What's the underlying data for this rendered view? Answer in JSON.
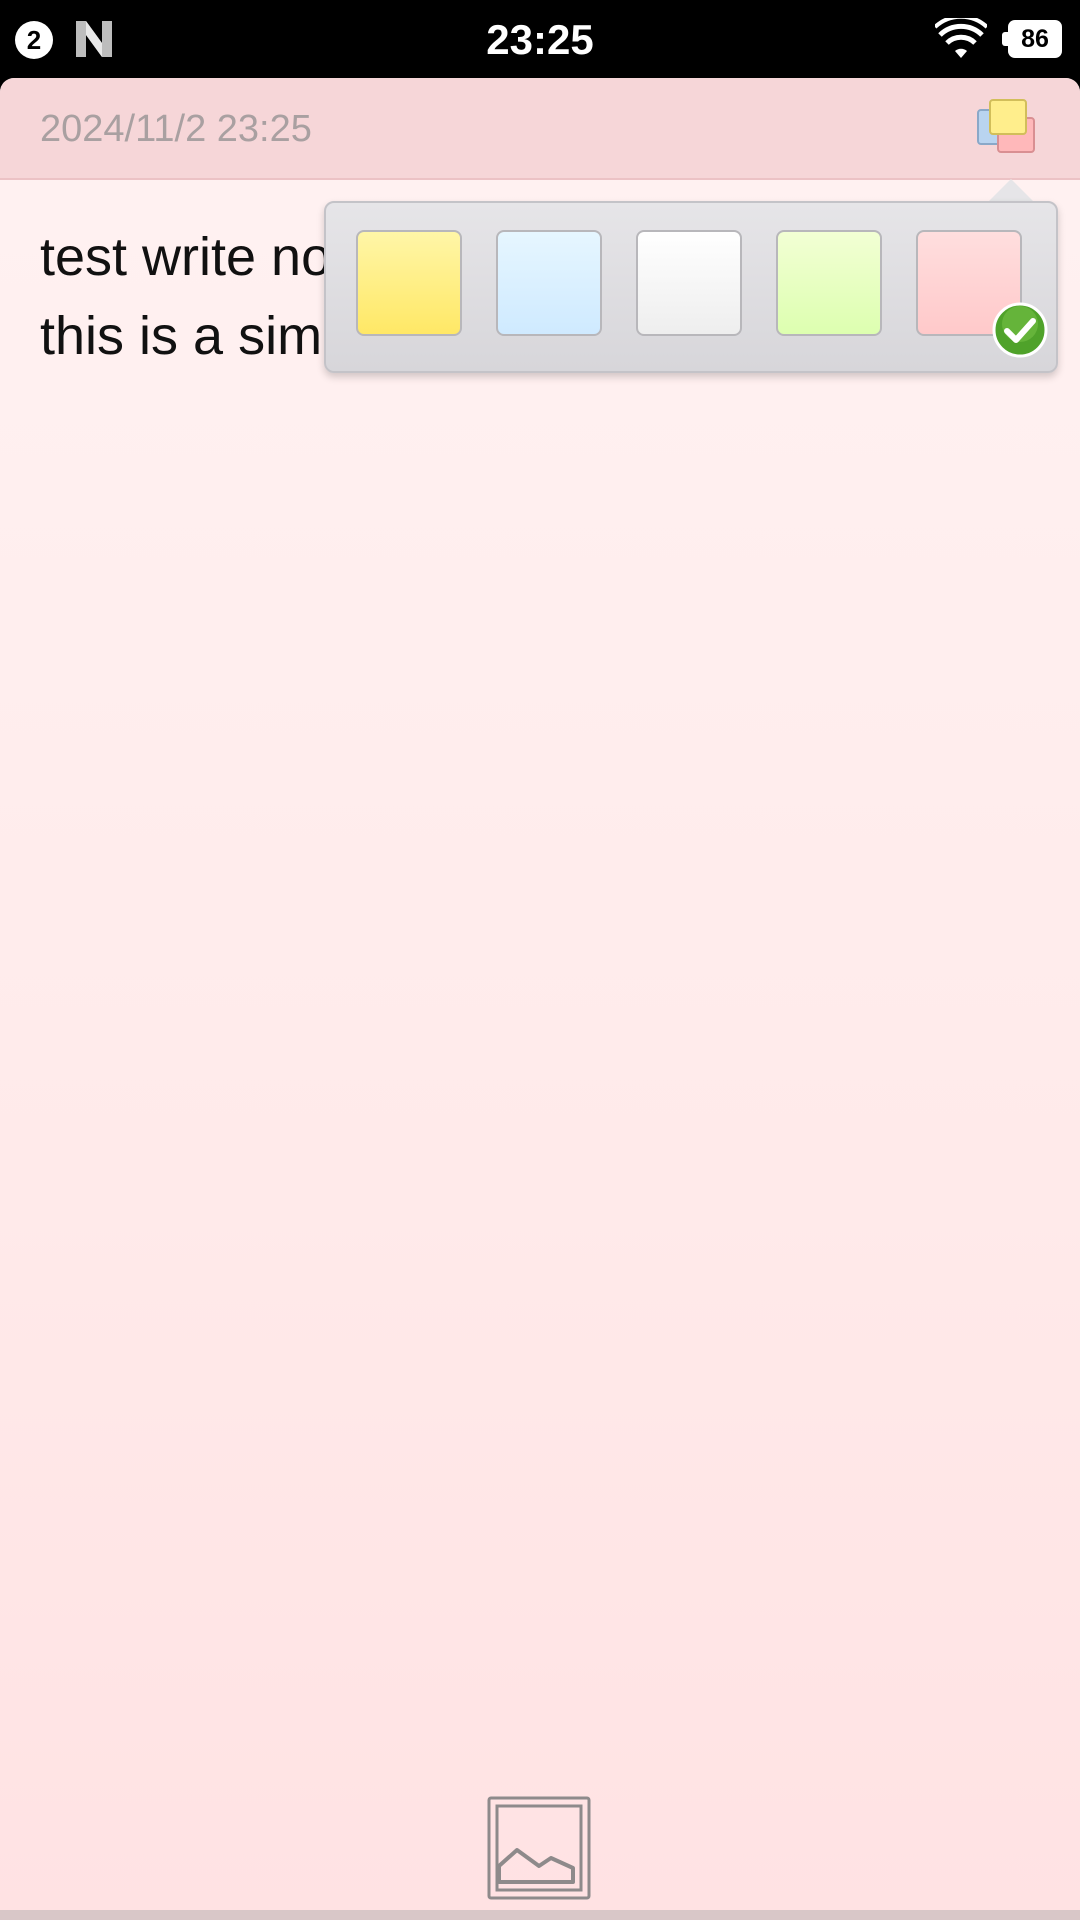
{
  "status_bar": {
    "notification_count": "2",
    "time": "23:25",
    "battery": "86",
    "icons": [
      "notification-count-icon",
      "n-app-icon",
      "wifi-icon",
      "battery-icon"
    ]
  },
  "note": {
    "date": "2024/11/2 23:25",
    "lines": [
      "test write note",
      "",
      "this is a simple note."
    ]
  },
  "color_picker": {
    "swatches": [
      {
        "name": "yellow",
        "color": "#ffee80",
        "selected": false
      },
      {
        "name": "blue",
        "color": "#d9efff",
        "selected": false
      },
      {
        "name": "white",
        "color": "#f7f7f7",
        "selected": false
      },
      {
        "name": "green",
        "color": "#e6ffc0",
        "selected": false
      },
      {
        "name": "pink",
        "color": "#ffd2d3",
        "selected": true
      }
    ],
    "selected_indicator": "check-icon"
  },
  "toolbar": {
    "insert_image_icon": "image-icon"
  },
  "colors": {
    "header_bg": "#f6d6d8",
    "note_bg": "#fff0f0",
    "date_text": "#a9a0a1",
    "check_green": "#4fa22a"
  }
}
